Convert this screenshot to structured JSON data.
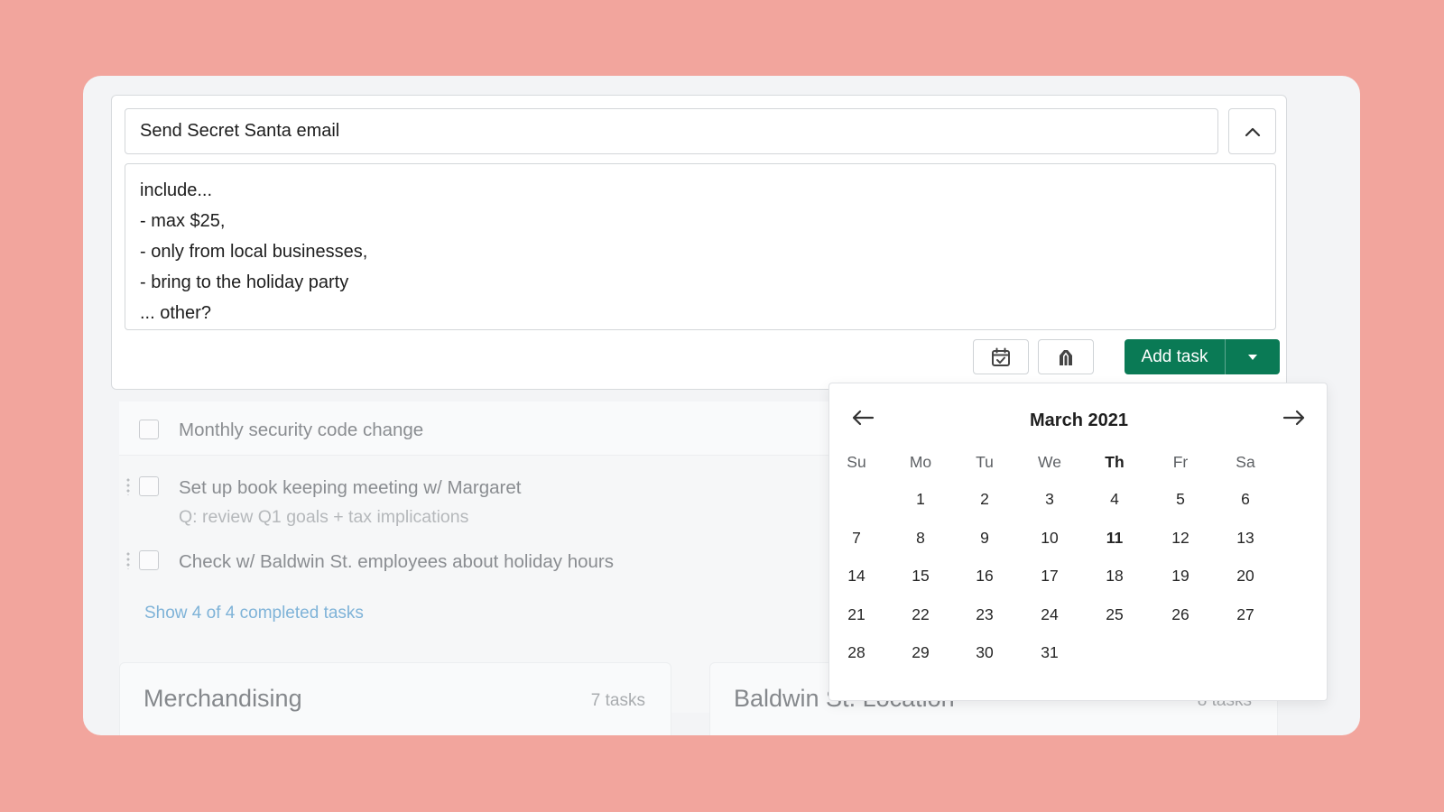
{
  "editor": {
    "title_value": "Send Secret Santa email",
    "notes_lines": [
      "include...",
      "- max $25,",
      "- only from local businesses,",
      "- bring to the holiday party",
      "... other?"
    ],
    "add_task_label": "Add task",
    "icons": {
      "collapse": "chevron-up-icon",
      "schedule": "calendar-check-icon",
      "tag": "tag-icon",
      "dropdown": "caret-down-icon"
    }
  },
  "tasks": [
    {
      "title": "Monthly security code change",
      "subtitle": ""
    },
    {
      "title": "Set up book keeping meeting w/ Margaret",
      "subtitle": "Q: review Q1 goals + tax implications"
    },
    {
      "title": "Check w/ Baldwin St. employees about holiday hours",
      "subtitle": ""
    }
  ],
  "show_completed_label": "Show 4 of 4 completed tasks",
  "sections": [
    {
      "name": "Merchandising",
      "count": "7 tasks"
    },
    {
      "name": "Baldwin St. Location",
      "count": "8 tasks"
    }
  ],
  "calendar": {
    "month_label": "March 2021",
    "weekdays": [
      "Su",
      "Mo",
      "Tu",
      "We",
      "Th",
      "Fr",
      "Sa"
    ],
    "current_weekday_index": 4,
    "first_weekday_index": 1,
    "days_in_month": 31,
    "today": 11,
    "prev_icon": "arrow-left-icon",
    "next_icon": "arrow-right-icon"
  },
  "colors": {
    "accent": "#0a7a55",
    "background": "#f2a59d",
    "link": "#7fb3d8"
  }
}
